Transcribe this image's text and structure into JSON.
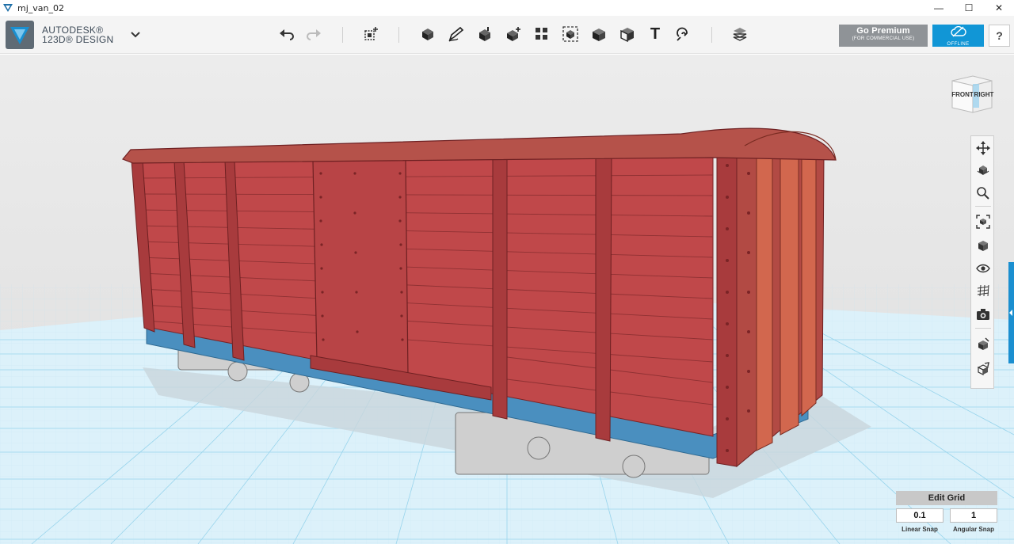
{
  "window": {
    "title": "mj_van_02",
    "controls": {
      "minimize": "—",
      "maximize": "☐",
      "close": "✕"
    }
  },
  "app": {
    "logo_line1": "AUTODESK®",
    "logo_line2": "123D® DESIGN"
  },
  "toolbar": {
    "tools": [
      {
        "name": "undo-icon"
      },
      {
        "name": "redo-icon"
      },
      {
        "name": "transform-icon"
      },
      {
        "name": "primitives-icon"
      },
      {
        "name": "sketch-icon"
      },
      {
        "name": "construct-icon"
      },
      {
        "name": "modify-icon"
      },
      {
        "name": "pattern-icon"
      },
      {
        "name": "grouping-icon"
      },
      {
        "name": "combine-icon"
      },
      {
        "name": "measure-icon"
      },
      {
        "name": "text-icon"
      },
      {
        "name": "snap-icon"
      },
      {
        "name": "material-icon"
      }
    ],
    "text_tool_glyph": "T",
    "premium_title": "Go Premium",
    "premium_sub": "(FOR COMMERCIAL USE)",
    "offline_label": "OFFLINE",
    "help_label": "?"
  },
  "viewcube": {
    "front": "FRONT",
    "right": "RIGHT"
  },
  "navbar": {
    "items": [
      "pan-icon",
      "orbit-icon",
      "zoom-icon",
      "fit-icon",
      "views-icon",
      "visibility-icon",
      "grid-icon",
      "screenshot-icon",
      "material-view-icon",
      "edit-view-icon"
    ]
  },
  "grid": {
    "edit_label": "Edit Grid",
    "linear_value": "0.1",
    "linear_label": "Linear Snap",
    "angular_value": "1",
    "angular_label": "Angular Snap"
  },
  "colors": {
    "accent": "#1196d6",
    "body_red": "#c0484a",
    "roof": "#b5524a",
    "chassis_blue": "#4a8fbf",
    "grid_line": "#8fcde8"
  }
}
